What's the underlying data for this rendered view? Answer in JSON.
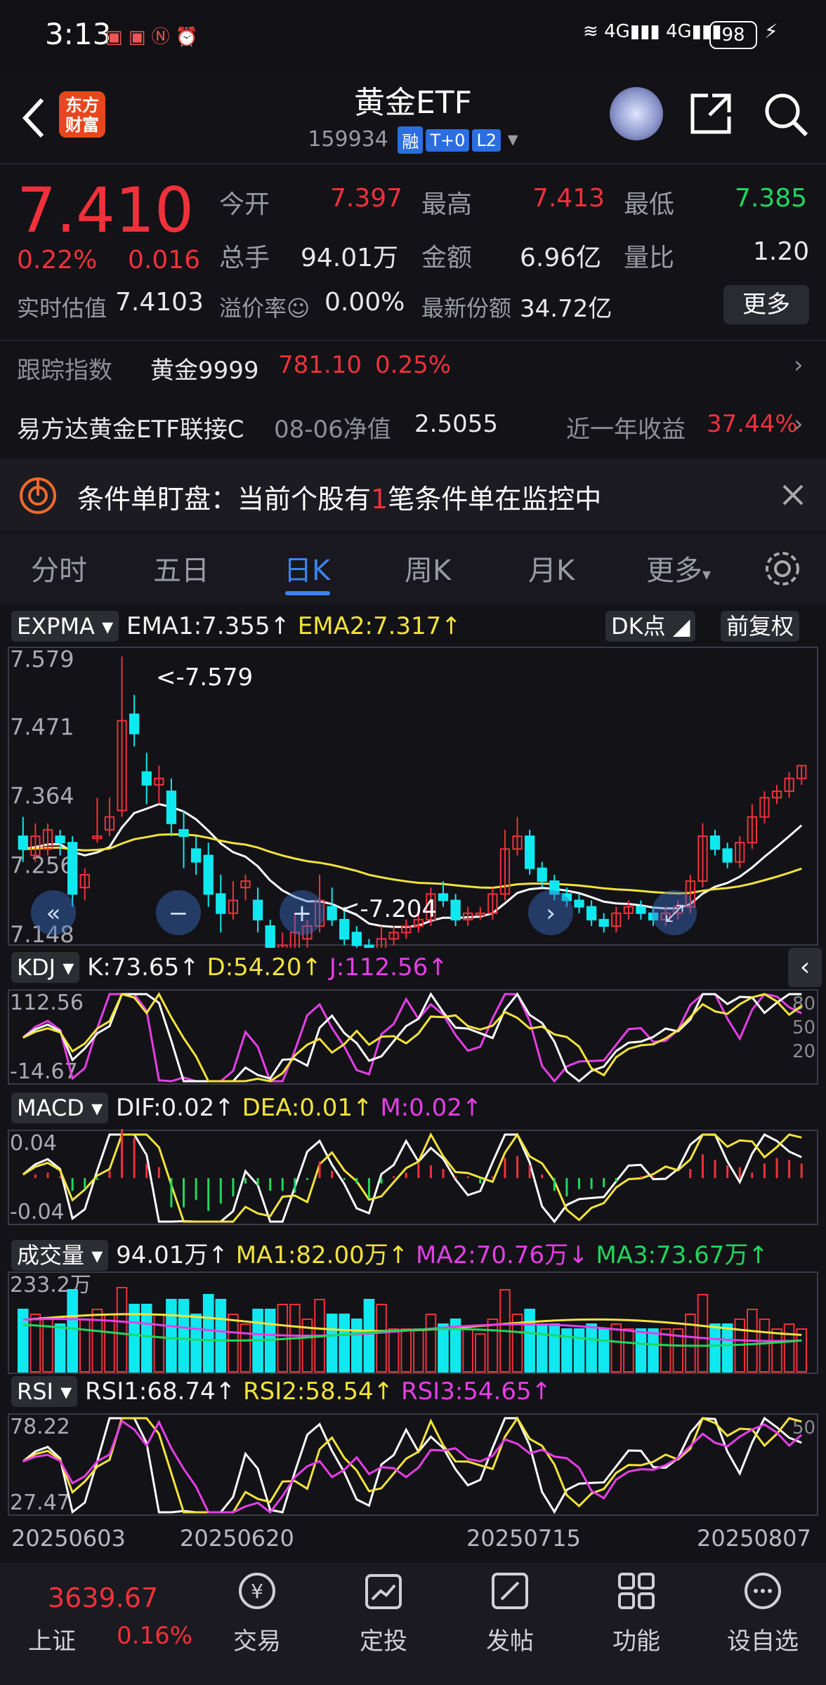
{
  "status": {
    "time": "3:13",
    "battery": "98",
    "signal1": "4G",
    "signal2": "4G"
  },
  "header": {
    "logo_line1": "东方",
    "logo_line2": "财富",
    "title": "黄金ETF",
    "code": "159934",
    "tags": [
      "融",
      "T+0",
      "L2"
    ]
  },
  "quote": {
    "price": "7.410",
    "change_pct": "0.22%",
    "change": "0.016",
    "open_label": "今开",
    "open": "7.397",
    "high_label": "最高",
    "high": "7.413",
    "low_label": "最低",
    "low": "7.385",
    "vol_label": "总手",
    "vol": "94.01万",
    "amount_label": "金额",
    "amount": "6.96亿",
    "ratio_label": "量比",
    "ratio": "1.20",
    "iopv_label": "实时估值",
    "iopv": "7.4103",
    "premium_label": "溢价率",
    "premium": "0.00%",
    "share_label": "最新份额",
    "share": "34.72亿",
    "more": "更多"
  },
  "track": {
    "label": "跟踪指数",
    "index": "黄金9999",
    "value": "781.10",
    "pct": "0.25%"
  },
  "fund": {
    "name": "易方达黄金ETF联接C",
    "nav_label": "08-06净值",
    "nav": "2.5055",
    "return_label": "近一年收益",
    "return": "37.44%"
  },
  "notice": {
    "text_a": "条件单盯盘：当前个股有",
    "count": "1",
    "text_b": "笔条件单在监控中"
  },
  "tabs": [
    "分时",
    "五日",
    "日K",
    "周K",
    "月K",
    "更多"
  ],
  "active_tab": "日K",
  "main_chart": {
    "indicator": "EXPMA",
    "ema1": "EMA1:7.355",
    "ema2": "EMA2:7.317",
    "dk": "DK点",
    "fq": "前复权",
    "yticks": [
      "7.579",
      "7.471",
      "7.364",
      "7.256",
      "7.148"
    ],
    "max_label": "<-7.579",
    "min_label": "<-7.204",
    "colors": {
      "up": "#f0313b",
      "down": "#10e8f0",
      "ema1": "#ffffff",
      "ema2": "#f3e33a"
    }
  },
  "kdj": {
    "name": "KDJ",
    "k": "K:73.65",
    "d": "D:54.20",
    "j": "J:112.56",
    "ytop": "112.56",
    "ybot": "-14.67",
    "r80": "80",
    "r50": "50",
    "r20": "20"
  },
  "macd": {
    "name": "MACD",
    "dif": "DIF:0.02",
    "dea": "DEA:0.01",
    "m": "M:0.02",
    "ytop": "0.04",
    "ybot": "-0.04"
  },
  "volume": {
    "name": "成交量",
    "v": "94.01万",
    "ma1": "MA1:82.00万",
    "ma2": "MA2:70.76万",
    "ma3": "MA3:73.67万",
    "ytop": "233.2万"
  },
  "rsi": {
    "name": "RSI",
    "r1": "RSI1:68.74",
    "r2": "RSI2:58.54",
    "r3": "RSI3:54.65",
    "ytop": "78.22",
    "ybot": "27.47",
    "r50": "50"
  },
  "dates": [
    "20250603",
    "20250620",
    "20250715",
    "20250807"
  ],
  "bottom": {
    "index_value": "3639.67",
    "index_name": "上证",
    "index_pct": "0.16%",
    "items": [
      "交易",
      "定投",
      "发帖",
      "功能",
      "设自选"
    ]
  },
  "chart_data": {
    "type": "candlestick",
    "series": [
      {
        "name": "K",
        "values": [
          [
            7.3,
            7.28,
            7.33,
            7.26
          ],
          [
            7.27,
            7.3,
            7.32,
            7.26
          ],
          [
            7.28,
            7.31,
            7.32,
            7.27
          ],
          [
            7.3,
            7.29,
            7.31,
            7.27
          ],
          [
            7.29,
            7.21,
            7.3,
            7.19
          ],
          [
            7.22,
            7.24,
            7.25,
            7.2
          ],
          [
            7.3,
            7.3,
            7.36,
            7.29
          ],
          [
            7.31,
            7.33,
            7.36,
            7.3
          ],
          [
            7.34,
            7.48,
            7.58,
            7.33
          ],
          [
            7.49,
            7.46,
            7.52,
            7.44
          ],
          [
            7.4,
            7.38,
            7.43,
            7.35
          ],
          [
            7.38,
            7.39,
            7.41,
            7.35
          ],
          [
            7.37,
            7.32,
            7.39,
            7.3
          ],
          [
            7.31,
            7.3,
            7.34,
            7.25
          ],
          [
            7.28,
            7.26,
            7.3,
            7.24
          ],
          [
            7.27,
            7.21,
            7.29,
            7.19
          ],
          [
            7.21,
            7.18,
            7.24,
            7.15
          ],
          [
            7.18,
            7.2,
            7.23,
            7.17
          ],
          [
            7.22,
            7.23,
            7.24,
            7.2
          ],
          [
            7.2,
            7.17,
            7.22,
            7.15
          ],
          [
            7.16,
            7.11,
            7.17,
            7.1
          ],
          [
            7.1,
            7.13,
            7.15,
            7.07
          ],
          [
            7.12,
            7.15,
            7.18,
            7.1
          ],
          [
            7.14,
            7.16,
            7.17,
            7.12
          ],
          [
            7.16,
            7.2,
            7.24,
            7.15
          ],
          [
            7.19,
            7.17,
            7.22,
            7.16
          ],
          [
            7.17,
            7.14,
            7.19,
            7.13
          ],
          [
            7.15,
            7.13,
            7.16,
            7.11
          ],
          [
            7.13,
            7.09,
            7.14,
            7.05
          ],
          [
            7.1,
            7.14,
            7.16,
            7.08
          ],
          [
            7.14,
            7.15,
            7.16,
            7.13
          ],
          [
            7.15,
            7.16,
            7.17,
            7.14
          ],
          [
            7.16,
            7.17,
            7.18,
            7.15
          ],
          [
            7.17,
            7.21,
            7.22,
            7.16
          ],
          [
            7.21,
            7.2,
            7.23,
            7.19
          ],
          [
            7.2,
            7.17,
            7.21,
            7.16
          ],
          [
            7.17,
            7.18,
            7.19,
            7.16
          ],
          [
            7.18,
            7.18,
            7.19,
            7.17
          ],
          [
            7.18,
            7.21,
            7.22,
            7.17
          ],
          [
            7.21,
            7.28,
            7.31,
            7.2
          ],
          [
            7.28,
            7.3,
            7.33,
            7.27
          ],
          [
            7.3,
            7.25,
            7.31,
            7.24
          ],
          [
            7.25,
            7.23,
            7.26,
            7.22
          ],
          [
            7.23,
            7.21,
            7.24,
            7.2
          ],
          [
            7.21,
            7.2,
            7.22,
            7.19
          ],
          [
            7.2,
            7.19,
            7.21,
            7.18
          ],
          [
            7.19,
            7.17,
            7.2,
            7.16
          ],
          [
            7.17,
            7.16,
            7.18,
            7.15
          ],
          [
            7.16,
            7.18,
            7.19,
            7.15
          ],
          [
            7.18,
            7.19,
            7.2,
            7.17
          ],
          [
            7.19,
            7.18,
            7.2,
            7.17
          ],
          [
            7.18,
            7.17,
            7.19,
            7.16
          ],
          [
            7.17,
            7.18,
            7.19,
            7.16
          ],
          [
            7.18,
            7.19,
            7.2,
            7.17
          ],
          [
            7.19,
            7.23,
            7.24,
            7.18
          ],
          [
            7.23,
            7.3,
            7.32,
            7.22
          ],
          [
            7.3,
            7.28,
            7.31,
            7.27
          ],
          [
            7.28,
            7.26,
            7.29,
            7.25
          ],
          [
            7.26,
            7.29,
            7.3,
            7.25
          ],
          [
            7.29,
            7.33,
            7.35,
            7.28
          ],
          [
            7.33,
            7.36,
            7.37,
            7.32
          ],
          [
            7.36,
            7.37,
            7.38,
            7.35
          ],
          [
            7.37,
            7.39,
            7.4,
            7.36
          ],
          [
            7.39,
            7.41,
            7.41,
            7.38
          ]
        ]
      }
    ],
    "ylim": [
      7.148,
      7.579
    ]
  }
}
